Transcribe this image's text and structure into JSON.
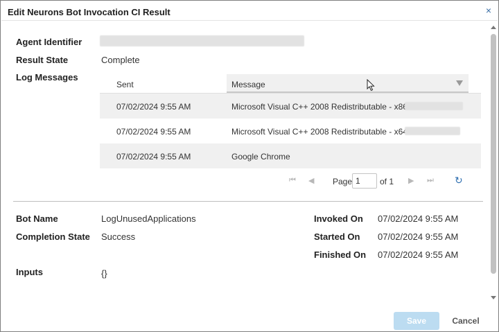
{
  "dialog": {
    "title": "Edit Neurons Bot Invocation CI Result",
    "close_glyph": "×"
  },
  "fields": {
    "agent_identifier_label": "Agent Identifier",
    "result_state_label": "Result State",
    "result_state_value": "Complete",
    "log_messages_label": "Log Messages"
  },
  "log_grid": {
    "columns": {
      "sent": "Sent",
      "message": "Message"
    },
    "rows": [
      {
        "sent": "07/02/2024 9:55 AM",
        "message": "Microsoft Visual C++ 2008 Redistributable - x86"
      },
      {
        "sent": "07/02/2024 9:55 AM",
        "message": "Microsoft Visual C++ 2008 Redistributable - x64"
      },
      {
        "sent": "07/02/2024 9:55 AM",
        "message": "Google Chrome"
      }
    ],
    "pager": {
      "page_label": "Page",
      "page_value": "1",
      "of_label": "of 1"
    }
  },
  "details": {
    "bot_name_label": "Bot Name",
    "bot_name_value": "LogUnusedApplications",
    "completion_state_label": "Completion State",
    "completion_state_value": "Success",
    "inputs_label": "Inputs",
    "inputs_value": "{}",
    "invoked_on_label": "Invoked On",
    "invoked_on_value": "07/02/2024 9:55 AM",
    "started_on_label": "Started On",
    "started_on_value": "07/02/2024 9:55 AM",
    "finished_on_label": "Finished On",
    "finished_on_value": "07/02/2024 9:55 AM"
  },
  "footer": {
    "save_label": "Save",
    "cancel_label": "Cancel"
  },
  "colors": {
    "accent": "#2f6fb0",
    "save_disabled": "#bcdcf1",
    "row_alt": "#f0f0f0"
  }
}
